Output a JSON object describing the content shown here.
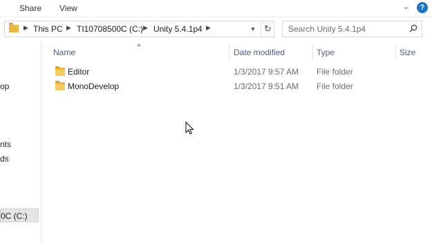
{
  "ribbon": {
    "tabs": [
      "Share",
      "View"
    ],
    "expand_icon": "chevron-down-icon",
    "help_label": "?"
  },
  "address": {
    "crumbs": [
      "This PC",
      "TI10708500C (C:)",
      "Unity 5.4.1p4"
    ]
  },
  "search": {
    "placeholder": "Search Unity 5.4.1p4"
  },
  "nav": {
    "items": [
      "op",
      "nts",
      "ds",
      "0C (C:)"
    ]
  },
  "columns": {
    "name": "Name",
    "date": "Date modified",
    "type": "Type",
    "size": "Size"
  },
  "files": [
    {
      "name": "Editor",
      "date": "1/3/2017 9:57 AM",
      "type": "File folder"
    },
    {
      "name": "MonoDevelop",
      "date": "1/3/2017 9:51 AM",
      "type": "File folder"
    }
  ],
  "colors": {
    "accent": "#1f6fc5",
    "folder": "#e8b84a"
  }
}
